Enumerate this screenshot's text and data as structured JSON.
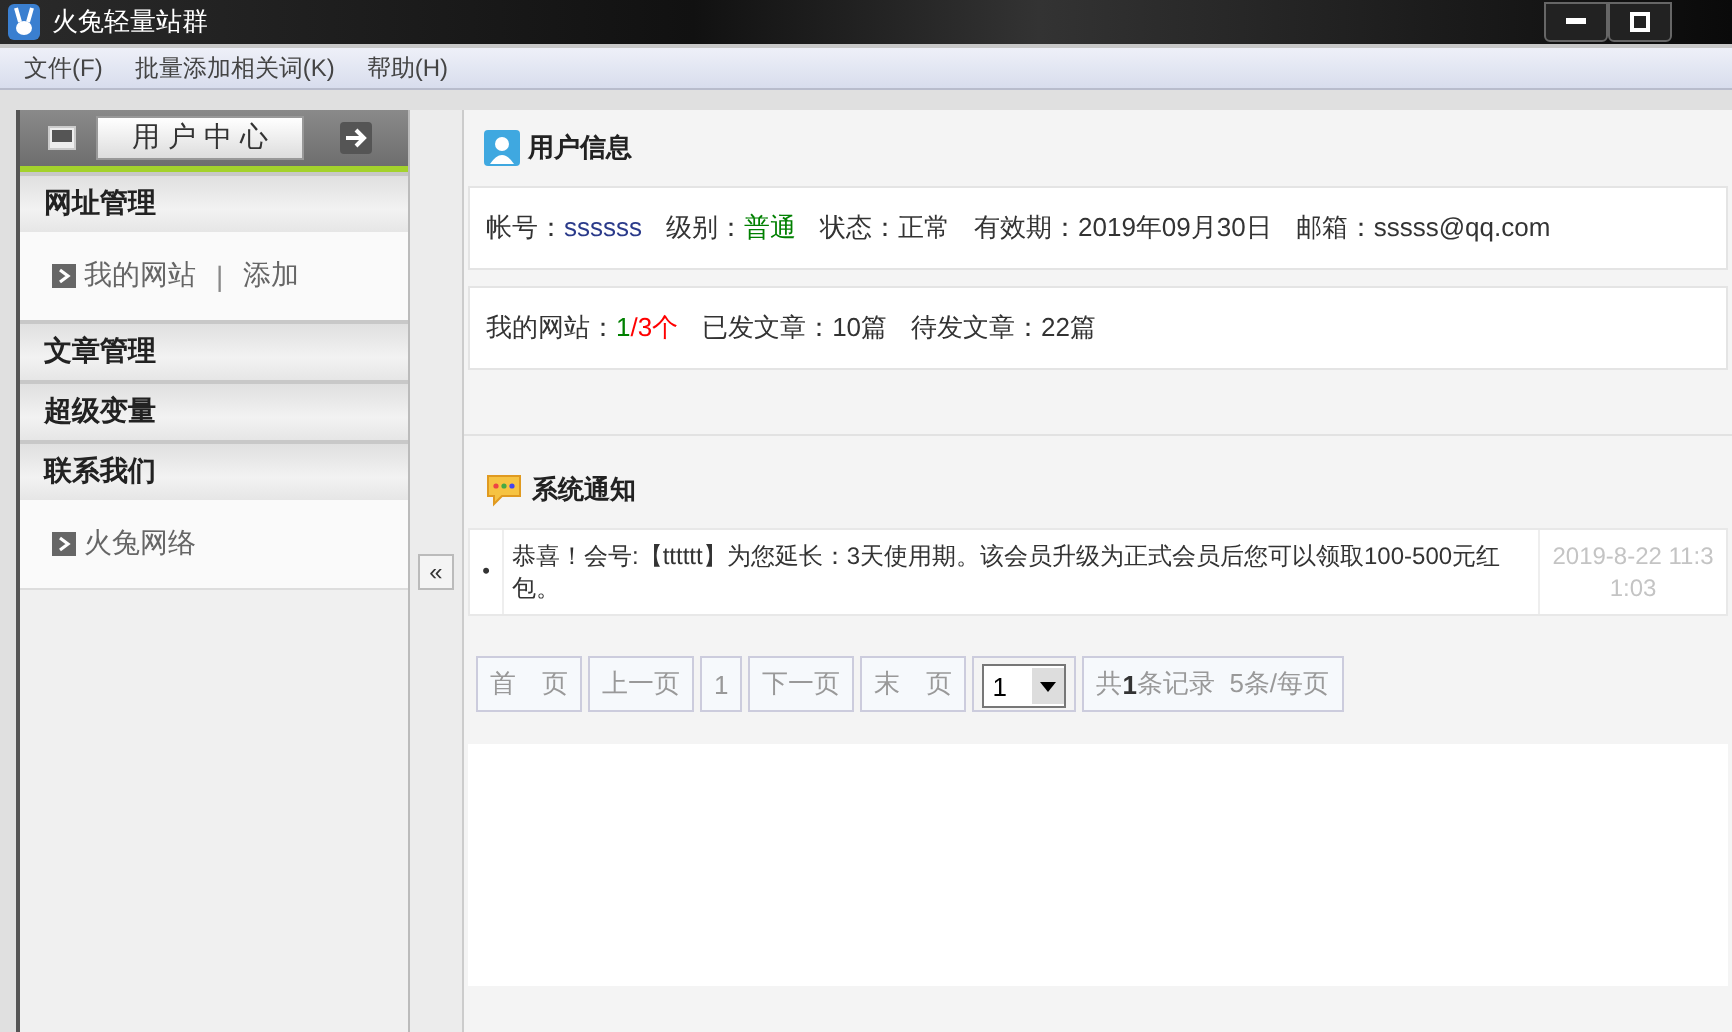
{
  "window": {
    "title": "火兔轻量站群"
  },
  "menu": [
    "文件(F)",
    "批量添加相关词(K)",
    "帮助(H)"
  ],
  "sidebar": {
    "header_button": "用 户 中 心",
    "sections": [
      {
        "title": "网址管理",
        "items": [
          {
            "links": [
              "我的网站",
              "添加"
            ],
            "separator": "|"
          }
        ]
      },
      {
        "title": "文章管理"
      },
      {
        "title": "超级变量"
      },
      {
        "title": "联系我们",
        "items": [
          {
            "links": [
              "火兔网络"
            ]
          }
        ]
      }
    ],
    "collapse_button": "«"
  },
  "user_info": {
    "title": "用户信息",
    "rows": [
      [
        {
          "label": "帐号：",
          "parts": [
            {
              "text": "ssssss",
              "color": "#2a3a8a"
            }
          ]
        },
        {
          "label": "级别：",
          "parts": [
            {
              "text": "普通",
              "color": "#008000"
            }
          ]
        },
        {
          "label": "状态：",
          "parts": [
            {
              "text": "正常",
              "color": "#333333"
            }
          ]
        },
        {
          "label": "有效期：",
          "parts": [
            {
              "text": "2019年09月30日",
              "color": "#333333"
            }
          ]
        },
        {
          "label": "邮箱：",
          "parts": [
            {
              "text": "sssss@qq.com",
              "color": "#333333"
            }
          ]
        }
      ],
      [
        {
          "label": "我的网站：",
          "parts": [
            {
              "text": "1",
              "color": "#008000"
            },
            {
              "text": "/3个",
              "color": "#ff0000"
            }
          ]
        },
        {
          "label": "已发文章：",
          "parts": [
            {
              "text": "10篇",
              "color": "#333333"
            }
          ]
        },
        {
          "label": "待发文章：",
          "parts": [
            {
              "text": "22篇",
              "color": "#333333"
            }
          ]
        }
      ]
    ]
  },
  "notices": {
    "title": "系统通知",
    "rows": [
      {
        "bullet": "•",
        "text": "恭喜！会号:【tttttt】为您延长：3天使用期。该会员升级为正式会员后您可以领取100-500元红包。",
        "time": "2019-8-22 11:31:03"
      }
    ],
    "pager": {
      "buttons": [
        "首　页",
        "上一页",
        "1",
        "下一页",
        "末　页"
      ],
      "page_select": "1",
      "summary": "共**1**条记录  5条/每页"
    }
  }
}
